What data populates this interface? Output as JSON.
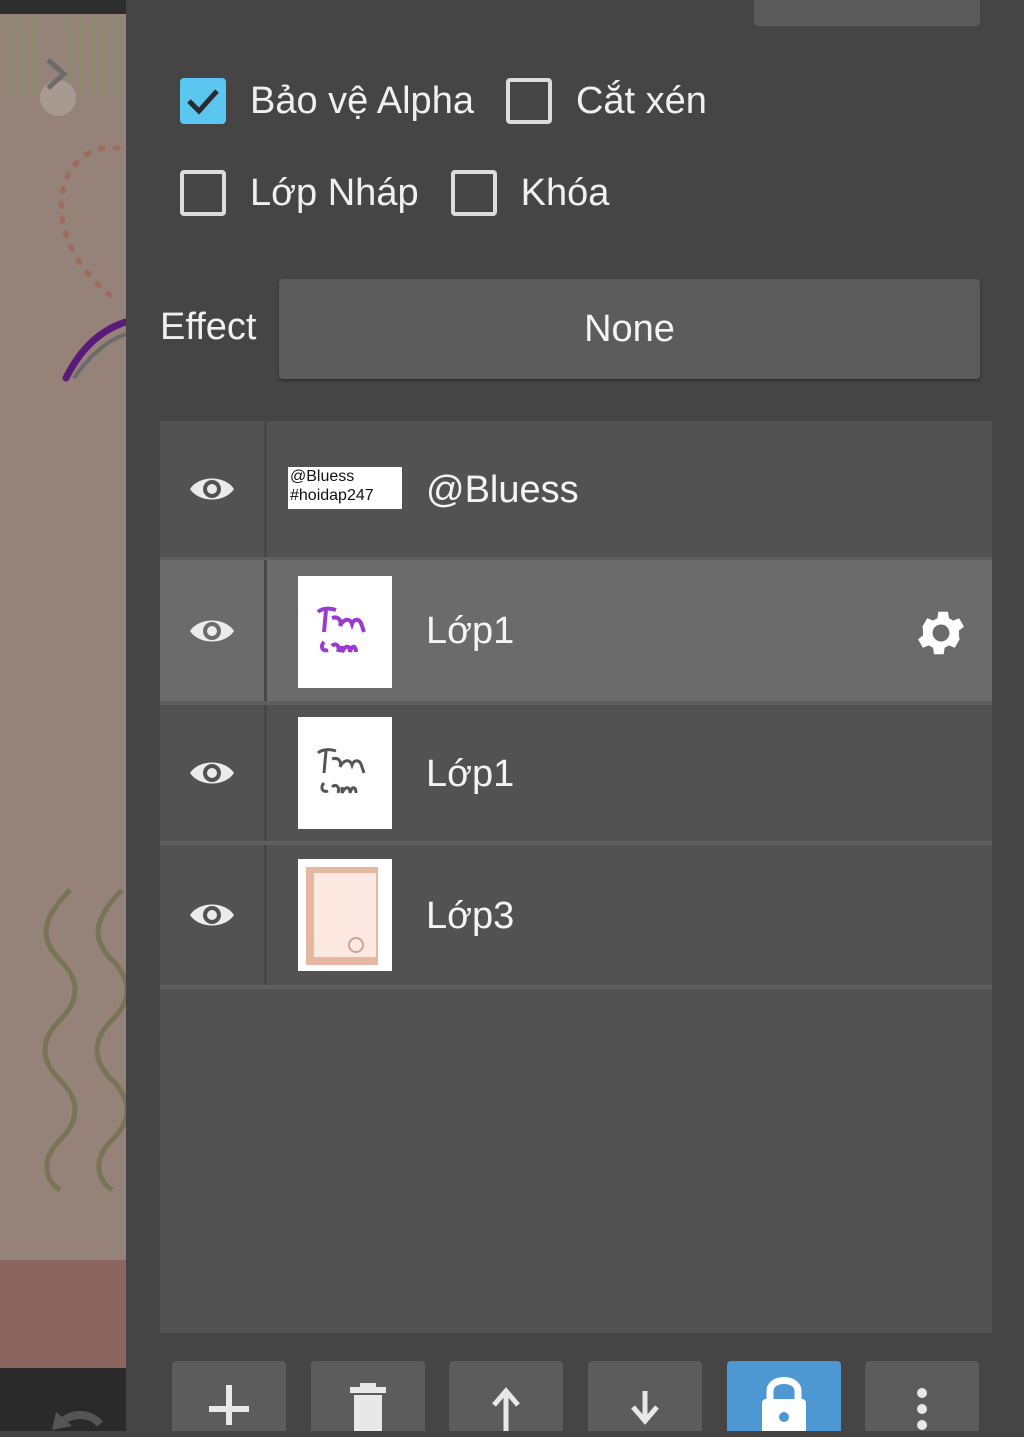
{
  "options": {
    "alpha_protect": {
      "label": "Bảo vệ Alpha",
      "checked": true
    },
    "clipping": {
      "label": "Cắt xén",
      "checked": false
    },
    "draft_layer": {
      "label": "Lớp Nháp",
      "checked": false
    },
    "lock": {
      "label": "Khóa",
      "checked": false
    }
  },
  "effect": {
    "label": "Effect",
    "value": "None"
  },
  "layers": [
    {
      "name": "@Bluess",
      "thumb_text": [
        "@Bluess",
        "#hoidap247"
      ],
      "visible": true,
      "selected": false
    },
    {
      "name": "Lớp1",
      "visible": true,
      "selected": true
    },
    {
      "name": "Lớp1",
      "visible": true,
      "selected": false
    },
    {
      "name": "Lớp3",
      "visible": true,
      "selected": false
    }
  ],
  "toolbar": [
    "add-icon",
    "trash-icon",
    "arrow-up-icon",
    "arrow-down-icon",
    "lock-icon",
    "more-vertical-icon"
  ],
  "colors": {
    "accent": "#5bc7f0",
    "active_tool": "#4d97d2",
    "panel": "#454545",
    "list": "#525252",
    "selected_row": "#6b6b6b"
  }
}
